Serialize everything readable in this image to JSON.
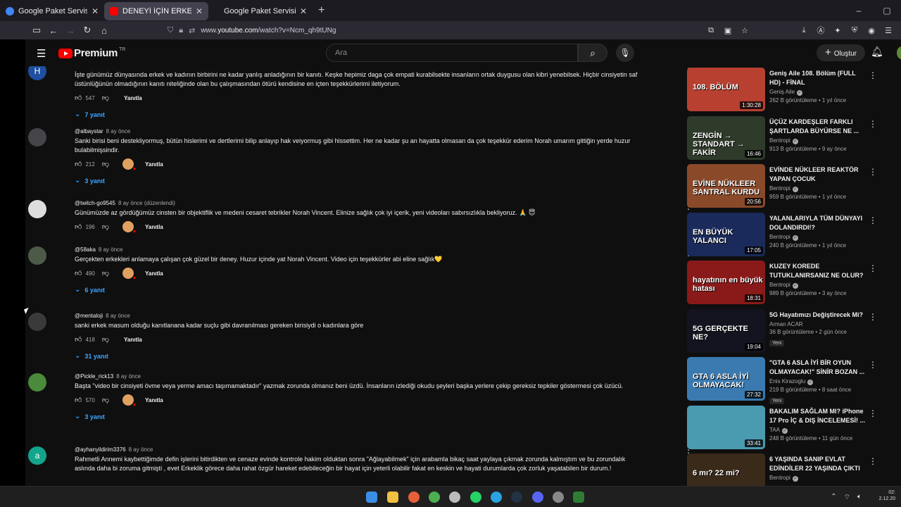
{
  "browser": {
    "tabs": [
      {
        "title": "Google Paket Servisi",
        "active": false
      },
      {
        "title": "DENEYİ İÇİN ERKEK ROLÜ YAPAN",
        "active": true
      },
      {
        "title": "Google Paket Servisi",
        "active": false
      }
    ],
    "url_prefix": "www.",
    "url_domain": "youtube.com",
    "url_path": "/watch?v=Ncm_qh9tUNg"
  },
  "masthead": {
    "logo_text": "Premium",
    "region": "TR",
    "search_placeholder": "Ara",
    "create_label": "Oluştur"
  },
  "comments": [
    {
      "author": "",
      "time": "",
      "avatar_letter": "H",
      "avatar_color": "#1e4fa0",
      "text": "İşte günümüz dünyasında erkek ve kadının birbirini ne kadar yanlış anladığının bir kanıtı. Keşke hepimiz daga çok empati kurabilsekte insanların ortak duygusu olan kibri yenebilsek. Hiçbir cinsiyetin saf üstünlüğünün olmadığının kanıtı niteliğinde olan bu çalışmasından ötürü kendisine en içten teşekkürlerimi iletiyorum.",
      "likes": "547",
      "reply_label": "Yanıtla",
      "replies": "7 yanıt",
      "hearted": false
    },
    {
      "author": "@albaystar",
      "time": "8 ay önce",
      "avatar_letter": "",
      "avatar_color": "#44444a",
      "text": "Sanki birisi beni destekliyormuş, bütün hislerimi ve dertlerimi bilip anlayıp hak veiyormuş gibi hissettim. Her ne kadar şu an hayatta olmasan da çok teşekkür ederim Norah umarım gittiğin yerde huzur bulabilmişsindir.",
      "likes": "212",
      "reply_label": "Yanıtla",
      "replies": "3 yanıt",
      "hearted": true
    },
    {
      "author": "@twitch-go9545",
      "time": "8 ay önce (düzenlendi)",
      "avatar_letter": "",
      "avatar_color": "#dddddd",
      "text": "Günümüzde az gördüğümüz cinsten bir objektiflik ve medeni cesaret tebrikler Norah Vincent. Elinize sağlık çok iyi içerik, yeni videoları sabırsızlıkla bekliyoruz. 🙏 😇",
      "likes": "196",
      "reply_label": "Yanıtla",
      "replies": "",
      "hearted": true
    },
    {
      "author": "@58aka",
      "time": "8 ay önce",
      "avatar_letter": "",
      "avatar_color": "#4d5a48",
      "text": "Gerçekten erkekleri anlamaya çalışan çok güzel bir deney. Huzur içinde yat Norah Vincent. Video için teşekkürler abi eline sağlık💛",
      "likes": "490",
      "reply_label": "Yanıtla",
      "replies": "6 yanıt",
      "hearted": true
    },
    {
      "author": "@mentaloji",
      "time": "8 ay önce",
      "avatar_letter": "",
      "avatar_color": "#3a3a3a",
      "text": "sanki erkek masum olduğu kanıtlanana kadar suçlu gibi davranılması gereken birisiydi o kadınlara göre",
      "likes": "418",
      "reply_label": "Yanıtla",
      "replies": "31 yanıt",
      "hearted": false
    },
    {
      "author": "@Pickle_rick13",
      "time": "8 ay önce",
      "avatar_letter": "",
      "avatar_color": "#4a8a3a",
      "text": "Başta \"video bir cinsiyeti övme veya yerme amacı taşımamaktadır\" yazmak zorunda olmanız beni üzdü. İnsanların izlediği okudu şeyleri başka yerlere çekip gereksiz tepkiler göstermesi çok üzücü.",
      "likes": "570",
      "reply_label": "Yanıtla",
      "replies": "3 yanıt",
      "hearted": true
    },
    {
      "author": "@ayhanyildirim3376",
      "time": "8 ay önce",
      "avatar_letter": "a",
      "avatar_color": "#12a58c",
      "text": "Rahmetli Annemi kaybettiğimde defin işlerini bitirdikten ve cenaze evinde kontrole hakim olduktan sonra \"Ağlayabilmek\" için arabamla bikaç saat yaylaya çıkmak zorunda kalmıştım ve bu zorundalık aslında daha bi zoruma gitmişti , evet Erkeklik görece daha rahat özgür hareket edebileceğin bir hayat için yeterli olabilir fakat en keskin ve hayati durumlarda çok zorluk yaşatabilen bir durum.!",
      "likes": "",
      "reply_label": "",
      "replies": "",
      "hearted": false
    }
  ],
  "sidebar": [
    {
      "title": "Geniş Aile 108. Bölüm (FULL HD) - FİNAL",
      "channel": "Geniş Aile",
      "verified": true,
      "meta": "262 B görüntüleme • 1 yıl önce",
      "duration": "1:30:28",
      "thumb_text": "108. BÖLÜM",
      "thumb_color": "#b84030",
      "badge": ""
    },
    {
      "title": "ÜÇÜZ KARDEŞLER FARKLI ŞARTLARDA BÜYÜRSE NE ...",
      "channel": "Bentropi",
      "verified": true,
      "meta": "913 B görüntüleme • 9 ay önce",
      "duration": "16:46",
      "thumb_text": "ZENGİN → STANDART → FAKİR",
      "thumb_color": "#2e3a2a",
      "badge": ""
    },
    {
      "title": "EVİNDE NÜKLEER REAKTÖR YAPAN ÇOCUK",
      "channel": "Bentropi",
      "verified": true,
      "meta": "959 B görüntüleme • 1 yıl önce",
      "duration": "20:56",
      "thumb_text": "EVİNE NÜKLEER SANTRAL KURDU",
      "thumb_color": "#8a4a2a",
      "badge": ""
    },
    {
      "title": "YALANLARIYLA TÜM DÜNYAYI DOLANDIRDI!?",
      "channel": "Bentropi",
      "verified": true,
      "meta": "240 B görüntüleme • 1 yıl önce",
      "duration": "17:05",
      "thumb_text": "EN BÜYÜK YALANCI",
      "thumb_color": "#1a2a5a",
      "badge": ""
    },
    {
      "title": "KUZEY KOREDE TUTUKLANIRSANIZ NE OLUR?",
      "channel": "Bentropi",
      "verified": true,
      "meta": "989 B görüntüleme • 3 ay önce",
      "duration": "18:31",
      "thumb_text": "hayatının en büyük hatası",
      "thumb_color": "#8a1a1a",
      "badge": ""
    },
    {
      "title": "5G Hayatımızı Değiştirecek Mi?",
      "channel": "Arman ACAR",
      "verified": false,
      "meta": "36 B görüntüleme • 2 gün önce",
      "duration": "19:04",
      "thumb_text": "5G GERÇEKTE NE?",
      "thumb_color": "#141420",
      "badge": "Yeni"
    },
    {
      "title": "\"GTA 6 ASLA İYİ BİR OYUN OLMAYACAK!\" SİNİR BOZAN ...",
      "channel": "Enis Kirazoglu",
      "verified": true,
      "meta": "219 B görüntüleme • 8 saat önce",
      "duration": "27:32",
      "thumb_text": "GTA 6 ASLA İYİ OLMAYACAK!",
      "thumb_color": "#3a7ab0",
      "badge": "Yeni"
    },
    {
      "title": "BAKALIM SAĞLAM MI? iPhone 17 Pro İÇ & DIŞ İNCELEMESİ! ...",
      "channel": "TAA",
      "verified": true,
      "meta": "248 B görüntüleme • 11 gün önce",
      "duration": "33:41",
      "thumb_text": "",
      "thumb_color": "#4a9ab0",
      "badge": ""
    },
    {
      "title": "6 YAŞINDA SANIP EVLAT EDİNDİLER 22 YAŞINDA ÇIKTI",
      "channel": "Bentropi",
      "verified": true,
      "meta": "",
      "duration": "",
      "thumb_text": "6 mı? 22 mi?",
      "thumb_color": "#3a2a1a",
      "badge": ""
    }
  ],
  "taskbar": {
    "time": "02:",
    "date": "2.12.20"
  },
  "colors": {
    "accent": "#3ea6ff",
    "brand": "#ff0000",
    "background": "#0f0f0f"
  }
}
